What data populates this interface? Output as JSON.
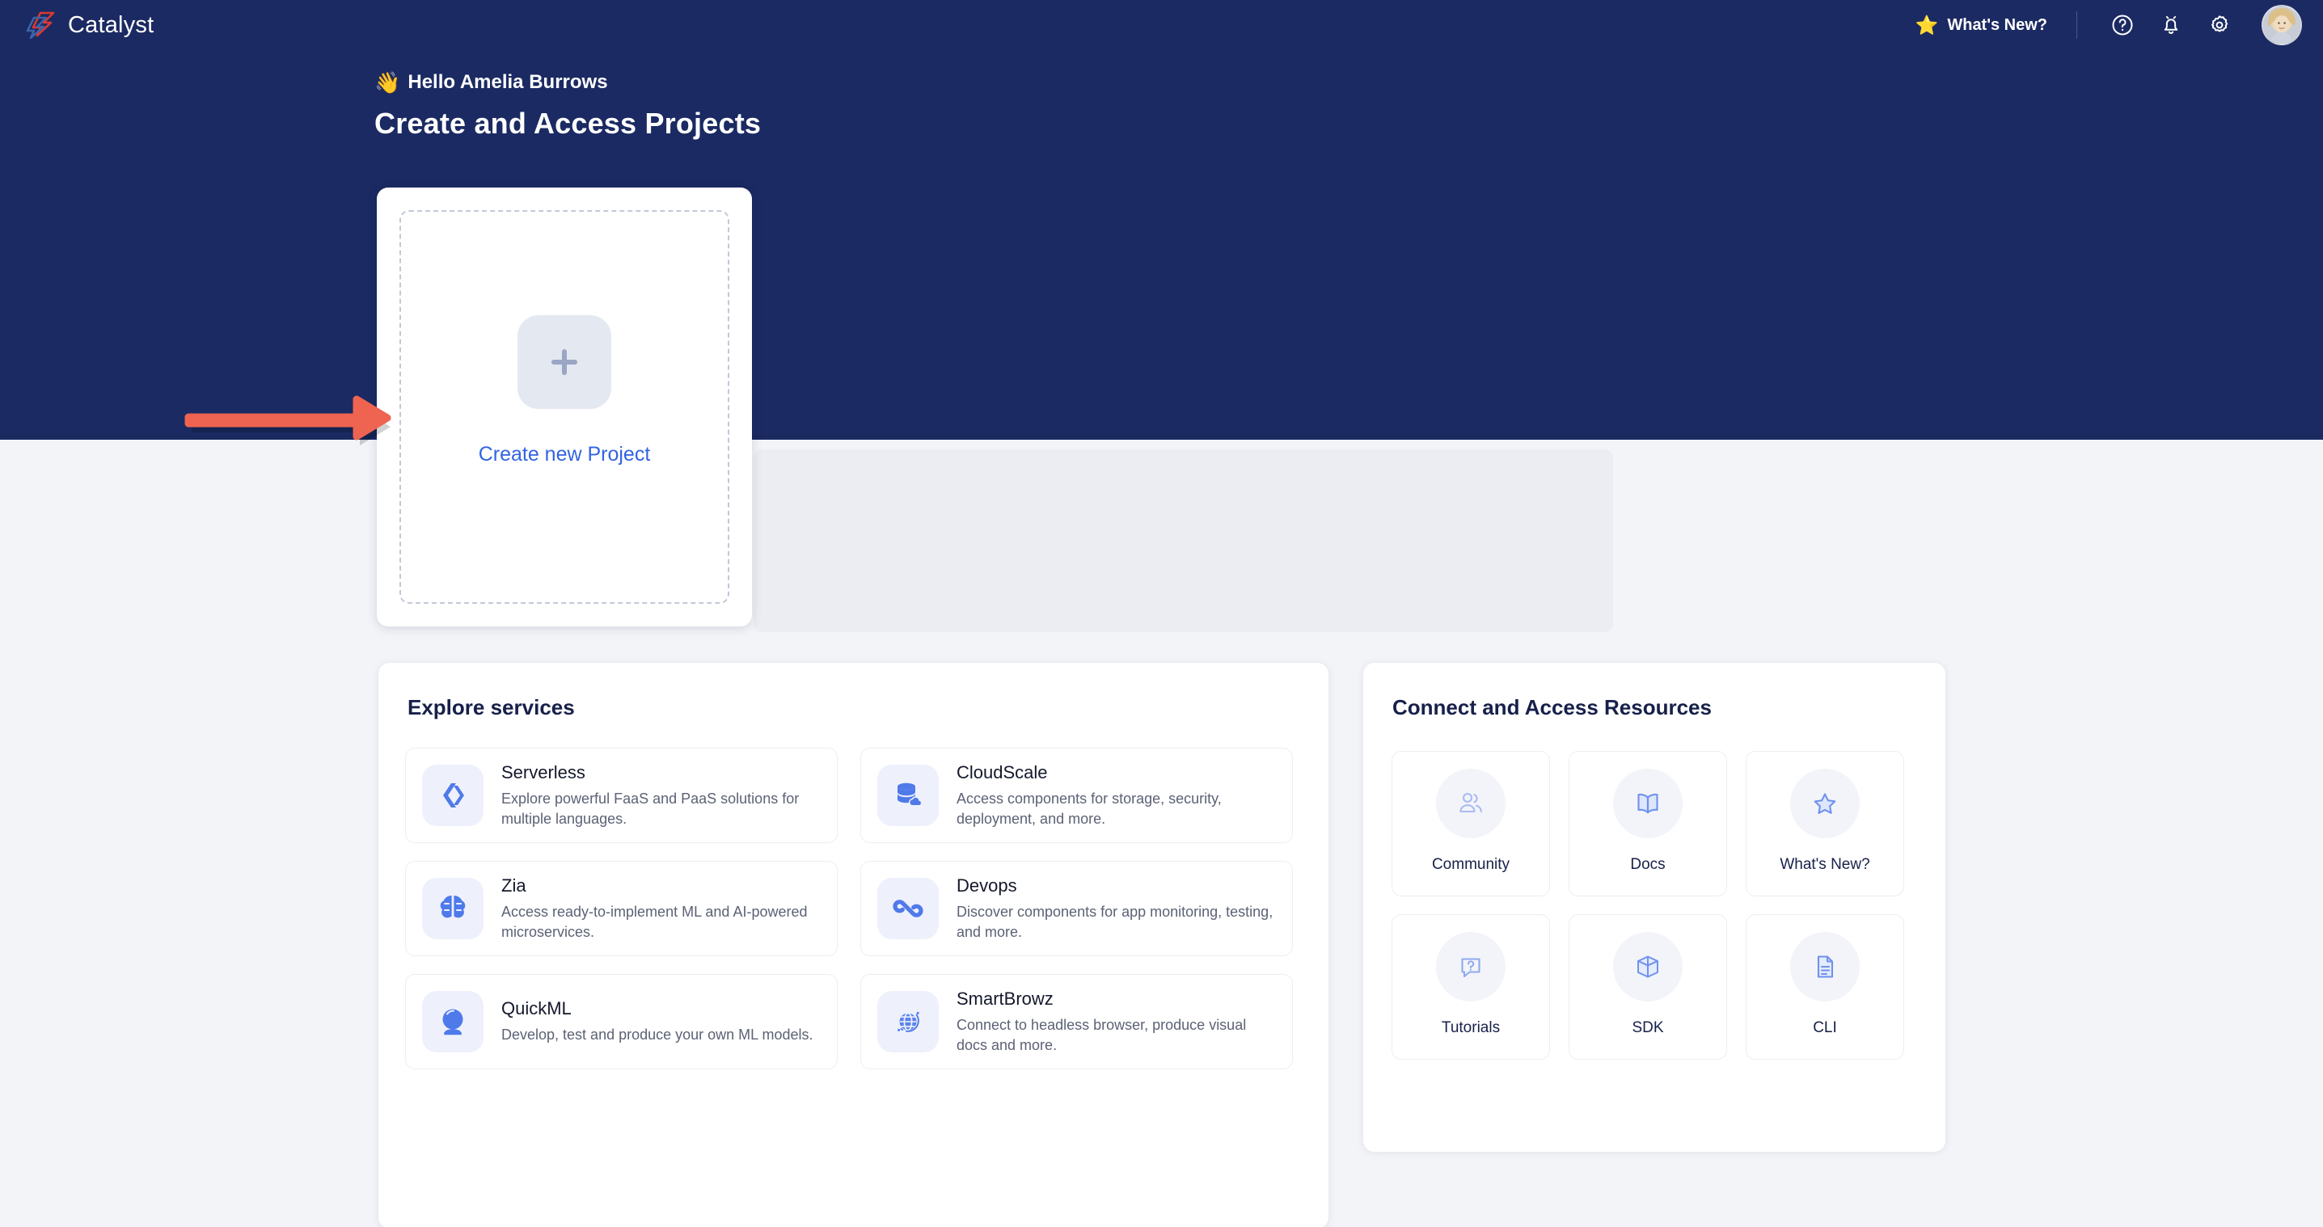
{
  "header": {
    "brand": "Catalyst",
    "whats_new_label": "What's New?",
    "star_glyph": "⭐",
    "icons": [
      "help-circle-icon",
      "bell-icon",
      "gear-icon",
      "avatar"
    ]
  },
  "hero": {
    "greeting": "Hello Amelia Burrows",
    "wave_glyph": "👋",
    "title": "Create and Access Projects",
    "background_color": "#1b2a62"
  },
  "project_card": {
    "create_label": "Create new Project",
    "plus_glyph": "+",
    "link_color": "#3264e0"
  },
  "annotation": {
    "arrow_color": "#ee6450",
    "direction": "right"
  },
  "services": {
    "title": "Explore services",
    "items": [
      {
        "name": "Serverless",
        "desc": "Explore powerful FaaS and PaaS solutions for multiple languages.",
        "icon": "chevrons-icon"
      },
      {
        "name": "CloudScale",
        "desc": "Access components for storage, security, deployment, and more.",
        "icon": "database-cloud-icon"
      },
      {
        "name": "Zia",
        "desc": "Access ready-to-implement ML and AI-powered microservices.",
        "icon": "brain-icon"
      },
      {
        "name": "Devops",
        "desc": "Discover components for app monitoring, testing, and more.",
        "icon": "infinity-links-icon"
      },
      {
        "name": "QuickML",
        "desc": "Develop, test and produce your own ML models.",
        "icon": "crystal-ball-icon"
      },
      {
        "name": "SmartBrowz",
        "desc": "Connect to headless browser, produce visual docs and more.",
        "icon": "globe-icon"
      }
    ]
  },
  "resources": {
    "title": "Connect and Access Resources",
    "items": [
      {
        "label": "Community",
        "icon": "users-icon"
      },
      {
        "label": "Docs",
        "icon": "open-book-icon"
      },
      {
        "label": "What's New?",
        "icon": "star-outline-icon"
      },
      {
        "label": "Tutorials",
        "icon": "question-bubble-icon"
      },
      {
        "label": "SDK",
        "icon": "box-3d-icon"
      },
      {
        "label": "CLI",
        "icon": "document-lines-icon"
      }
    ]
  },
  "theme": {
    "navy": "#1b2a62",
    "page_bg": "#f2f4f8",
    "accent_blue": "#4f7aea",
    "icon_tile_bg": "#eef1fc"
  }
}
